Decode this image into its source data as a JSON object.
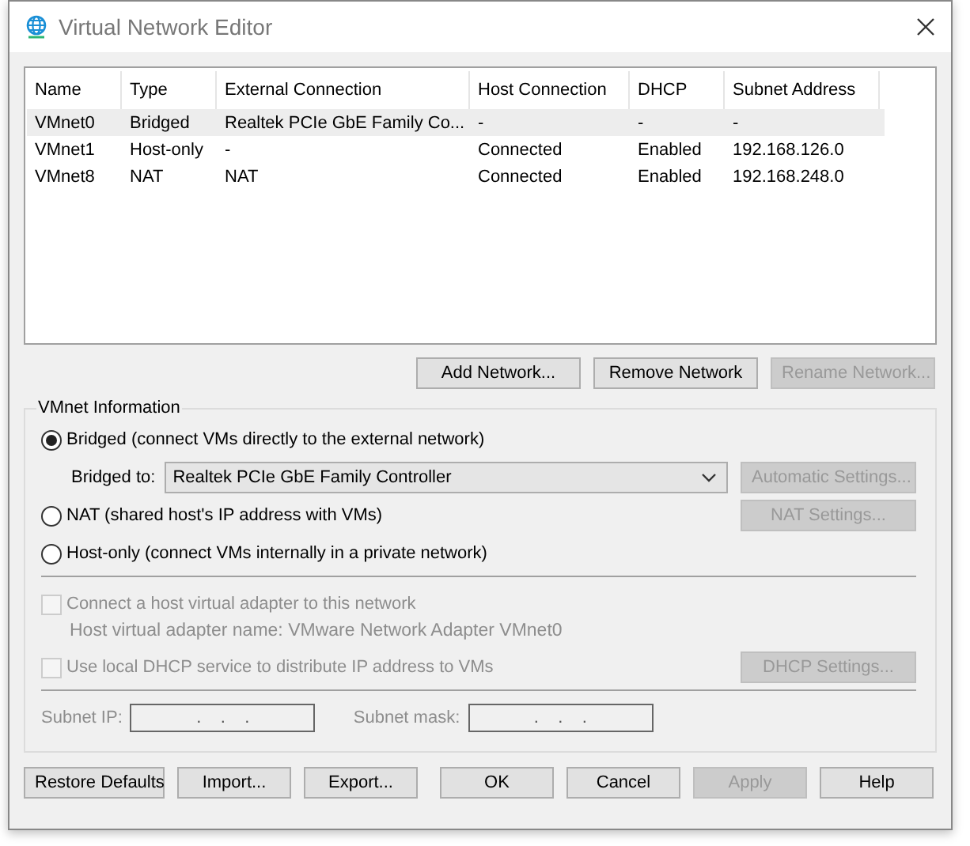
{
  "window": {
    "title": "Virtual Network Editor"
  },
  "table": {
    "columns": [
      "Name",
      "Type",
      "External Connection",
      "Host Connection",
      "DHCP",
      "Subnet Address"
    ],
    "rows": [
      {
        "cells": [
          "VMnet0",
          "Bridged",
          "Realtek PCIe GbE Family Co...",
          "-",
          "-",
          "-"
        ],
        "selected": true
      },
      {
        "cells": [
          "VMnet1",
          "Host-only",
          "-",
          "Connected",
          "Enabled",
          "192.168.126.0"
        ],
        "selected": false
      },
      {
        "cells": [
          "VMnet8",
          "NAT",
          "NAT",
          "Connected",
          "Enabled",
          "192.168.248.0"
        ],
        "selected": false
      }
    ]
  },
  "network_buttons": [
    {
      "label": "Add Network...",
      "disabled": false
    },
    {
      "label": "Remove Network",
      "disabled": false
    },
    {
      "label": "Rename Network...",
      "disabled": true
    }
  ],
  "vmnet_info": {
    "title": "VMnet Information",
    "modes": [
      {
        "label": "Bridged (connect VMs directly to the external network)",
        "selected": true
      },
      {
        "label": "NAT (shared host's IP address with VMs)",
        "selected": false,
        "button": {
          "label": "NAT Settings...",
          "disabled": true
        }
      },
      {
        "label": "Host-only (connect VMs internally in a private network)",
        "selected": false
      }
    ],
    "bridged_to": {
      "label": "Bridged to:",
      "value": "Realtek PCIe GbE Family Controller",
      "button": {
        "label": "Automatic Settings...",
        "disabled": true
      }
    },
    "host_adapter": {
      "label": "Connect a host virtual adapter to this network",
      "checked": false,
      "disabled": true,
      "note": "Host virtual adapter name: VMware Network Adapter VMnet0"
    },
    "dhcp": {
      "label": "Use local DHCP service to distribute IP address to VMs",
      "checked": false,
      "disabled": true,
      "button": {
        "label": "DHCP Settings...",
        "disabled": true
      }
    },
    "subnet_ip": {
      "label": "Subnet IP:",
      "value": ".    .    .",
      "disabled": true
    },
    "subnet_mask": {
      "label": "Subnet mask:",
      "value": ".    .    .",
      "disabled": true
    }
  },
  "buttons": [
    {
      "label": "Restore Defaults",
      "disabled": false
    },
    {
      "label": "Import...",
      "disabled": false
    },
    {
      "label": "Export...",
      "disabled": false
    },
    {
      "label": "OK",
      "disabled": false
    },
    {
      "label": "Cancel",
      "disabled": false
    },
    {
      "label": "Apply",
      "disabled": true
    },
    {
      "label": "Help",
      "disabled": false
    }
  ]
}
